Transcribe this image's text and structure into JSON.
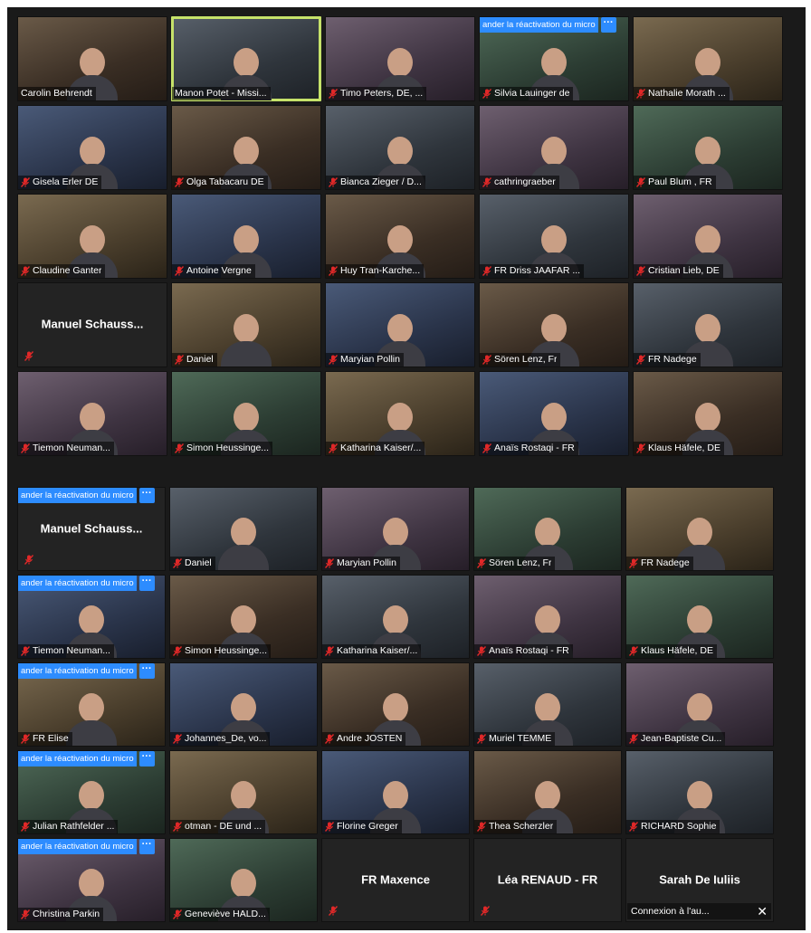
{
  "banner": {
    "text": "ander la réactivation du micro",
    "more": "···"
  },
  "grid_top": [
    {
      "name": "Carolin Behrendt",
      "muted": false,
      "active": false,
      "banner": false,
      "video": true
    },
    {
      "name": "Manon Potet - Missi...",
      "muted": false,
      "active": true,
      "banner": false,
      "video": true
    },
    {
      "name": "Timo Peters, DE, ...",
      "muted": true,
      "active": false,
      "banner": false,
      "video": true
    },
    {
      "name": "Silvia Lauinger  de",
      "muted": true,
      "active": false,
      "banner": true,
      "video": true
    },
    {
      "name": "Nathalie Morath ...",
      "muted": true,
      "active": false,
      "banner": false,
      "video": true
    },
    {
      "name": "Gisela Erler DE",
      "muted": true,
      "active": false,
      "banner": false,
      "video": true
    },
    {
      "name": "Olga Tabacaru DE",
      "muted": true,
      "active": false,
      "banner": false,
      "video": true
    },
    {
      "name": "Bianca Zieger / D...",
      "muted": true,
      "active": false,
      "banner": false,
      "video": true
    },
    {
      "name": "cathringraeber",
      "muted": true,
      "active": false,
      "banner": false,
      "video": true
    },
    {
      "name": "Paul Blum , FR",
      "muted": true,
      "active": false,
      "banner": false,
      "video": true
    },
    {
      "name": "Claudine Ganter",
      "muted": true,
      "active": false,
      "banner": false,
      "video": true
    },
    {
      "name": "Antoine Vergne",
      "muted": true,
      "active": false,
      "banner": false,
      "video": true
    },
    {
      "name": "Huy Tran-Karche...",
      "muted": true,
      "active": false,
      "banner": false,
      "video": true
    },
    {
      "name": "FR Driss JAAFAR ...",
      "muted": true,
      "active": false,
      "banner": false,
      "video": true
    },
    {
      "name": "Cristian Lieb, DE",
      "muted": true,
      "active": false,
      "banner": false,
      "video": true
    },
    {
      "name": "Manuel  Schauss...",
      "muted": true,
      "active": false,
      "banner": false,
      "video": false
    },
    {
      "name": "Daniel",
      "muted": true,
      "active": false,
      "banner": false,
      "video": true
    },
    {
      "name": "Maryian Pollin",
      "muted": true,
      "active": false,
      "banner": false,
      "video": true
    },
    {
      "name": "Sören Lenz, Fr",
      "muted": true,
      "active": false,
      "banner": false,
      "video": true
    },
    {
      "name": "FR Nadege",
      "muted": true,
      "active": false,
      "banner": false,
      "video": true
    },
    {
      "name": "Tiemon Neuman...",
      "muted": true,
      "active": false,
      "banner": false,
      "video": true
    },
    {
      "name": "Simon Heussinge...",
      "muted": true,
      "active": false,
      "banner": false,
      "video": true
    },
    {
      "name": "Katharina Kaiser/...",
      "muted": true,
      "active": false,
      "banner": false,
      "video": true
    },
    {
      "name": "Anaïs Rostaqi - FR",
      "muted": true,
      "active": false,
      "banner": false,
      "video": true
    },
    {
      "name": "Klaus Häfele, DE",
      "muted": true,
      "active": false,
      "banner": false,
      "video": true
    }
  ],
  "grid_bottom": [
    {
      "name": "Manuel  Schauss...",
      "muted": true,
      "active": false,
      "banner": true,
      "video": false
    },
    {
      "name": "Daniel",
      "muted": true,
      "active": false,
      "banner": false,
      "video": true
    },
    {
      "name": "Maryian Pollin",
      "muted": true,
      "active": false,
      "banner": false,
      "video": true
    },
    {
      "name": "Sören Lenz, Fr",
      "muted": true,
      "active": false,
      "banner": false,
      "video": true
    },
    {
      "name": "FR Nadege",
      "muted": true,
      "active": false,
      "banner": false,
      "video": true
    },
    {
      "name": "Tiemon Neuman...",
      "muted": true,
      "active": false,
      "banner": true,
      "video": true
    },
    {
      "name": "Simon Heussinge...",
      "muted": true,
      "active": false,
      "banner": false,
      "video": true
    },
    {
      "name": "Katharina Kaiser/...",
      "muted": true,
      "active": false,
      "banner": false,
      "video": true
    },
    {
      "name": "Anaïs Rostaqi - FR",
      "muted": true,
      "active": false,
      "banner": false,
      "video": true
    },
    {
      "name": "Klaus Häfele, DE",
      "muted": true,
      "active": false,
      "banner": false,
      "video": true
    },
    {
      "name": "FR Elise",
      "muted": true,
      "active": false,
      "banner": true,
      "video": true
    },
    {
      "name": "Johannes_De, vo...",
      "muted": true,
      "active": false,
      "banner": false,
      "video": true
    },
    {
      "name": "Andre JOSTEN",
      "muted": true,
      "active": false,
      "banner": false,
      "video": true
    },
    {
      "name": "Muriel TEMME",
      "muted": true,
      "active": false,
      "banner": false,
      "video": true
    },
    {
      "name": "Jean-Baptiste Cu...",
      "muted": true,
      "active": false,
      "banner": false,
      "video": true
    },
    {
      "name": "Julian Rathfelder ...",
      "muted": true,
      "active": false,
      "banner": true,
      "video": true
    },
    {
      "name": "otman - DE und ...",
      "muted": true,
      "active": false,
      "banner": false,
      "video": true
    },
    {
      "name": "Florine Greger",
      "muted": true,
      "active": false,
      "banner": false,
      "video": true
    },
    {
      "name": "Thea Scherzler",
      "muted": true,
      "active": false,
      "banner": false,
      "video": true
    },
    {
      "name": "RICHARD Sophie",
      "muted": true,
      "active": false,
      "banner": false,
      "video": true
    },
    {
      "name": "Christina Parkin",
      "muted": true,
      "active": false,
      "banner": true,
      "video": true
    },
    {
      "name": "Geneviève HALD...",
      "muted": true,
      "active": false,
      "banner": false,
      "video": true
    },
    {
      "name": "FR Maxence",
      "muted": true,
      "active": false,
      "banner": false,
      "video": false
    },
    {
      "name": "Léa RENAUD - FR",
      "muted": true,
      "active": false,
      "banner": false,
      "video": false
    },
    {
      "name": "Sarah De Iuliis",
      "muted": false,
      "active": false,
      "banner": false,
      "video": false,
      "status": "Connexion à l'au..."
    }
  ],
  "colors": {
    "muted_icon": "#e02828",
    "active_speaker_border": "#c6e26a",
    "banner_blue": "#2d8cff",
    "background": "#1a1a1a"
  }
}
